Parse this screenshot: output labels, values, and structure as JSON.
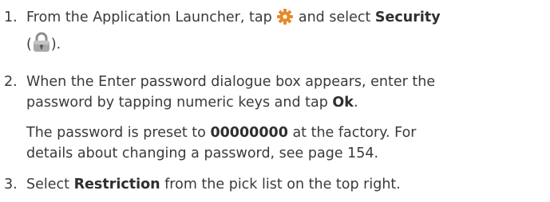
{
  "steps": [
    {
      "number": "1.",
      "line1_a": "From the Application Launcher, tap",
      "line1_b": "and select",
      "line1_bold": "Security",
      "line2_open": "(",
      "line2_close": ")."
    },
    {
      "number": "2.",
      "line1": "When the Enter password dialogue box appears, enter the",
      "line2_a": "password by tapping numeric keys and tap",
      "line2_bold": "Ok",
      "line2_end": "."
    },
    {
      "number": "3.",
      "text_a": "Select",
      "text_bold": "Restriction",
      "text_b": "from the pick list on the top right."
    }
  ],
  "note": {
    "line1_a": "The password is preset to",
    "line1_bold": "00000000",
    "line1_b": "at the factory. For",
    "line2": "details about changing a password, see page 154."
  },
  "icons": {
    "settings": "gear-icon",
    "security": "padlock-icon"
  },
  "colors": {
    "text": "#3a3a3a",
    "gear_orange": "#e8892a",
    "lock_gray": "#9a9a9a"
  }
}
